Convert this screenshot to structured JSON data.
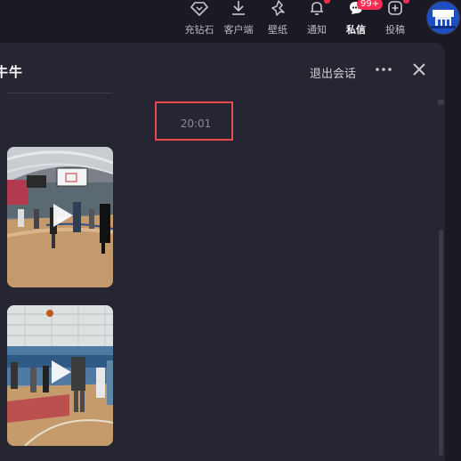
{
  "nav": {
    "items": [
      {
        "label": "充钻石",
        "icon": "diamond-icon"
      },
      {
        "label": "客户端",
        "icon": "download-icon"
      },
      {
        "label": "壁纸",
        "icon": "wallpaper-icon"
      },
      {
        "label": "通知",
        "icon": "bell-icon"
      },
      {
        "label": "私信",
        "icon": "message-icon"
      },
      {
        "label": "投稿",
        "icon": "upload-icon"
      }
    ],
    "message_badge": "99+"
  },
  "chat": {
    "title": "牛牛",
    "exit_label": "退出会话",
    "timestamp": "20:01",
    "messages": [
      {
        "type": "video",
        "icon": "play-icon"
      },
      {
        "type": "video",
        "icon": "play-icon"
      }
    ]
  },
  "colors": {
    "background": "#1a1a24",
    "panel": "#252632",
    "accent": "#fe2c55",
    "highlight": "#ea4a4a"
  }
}
